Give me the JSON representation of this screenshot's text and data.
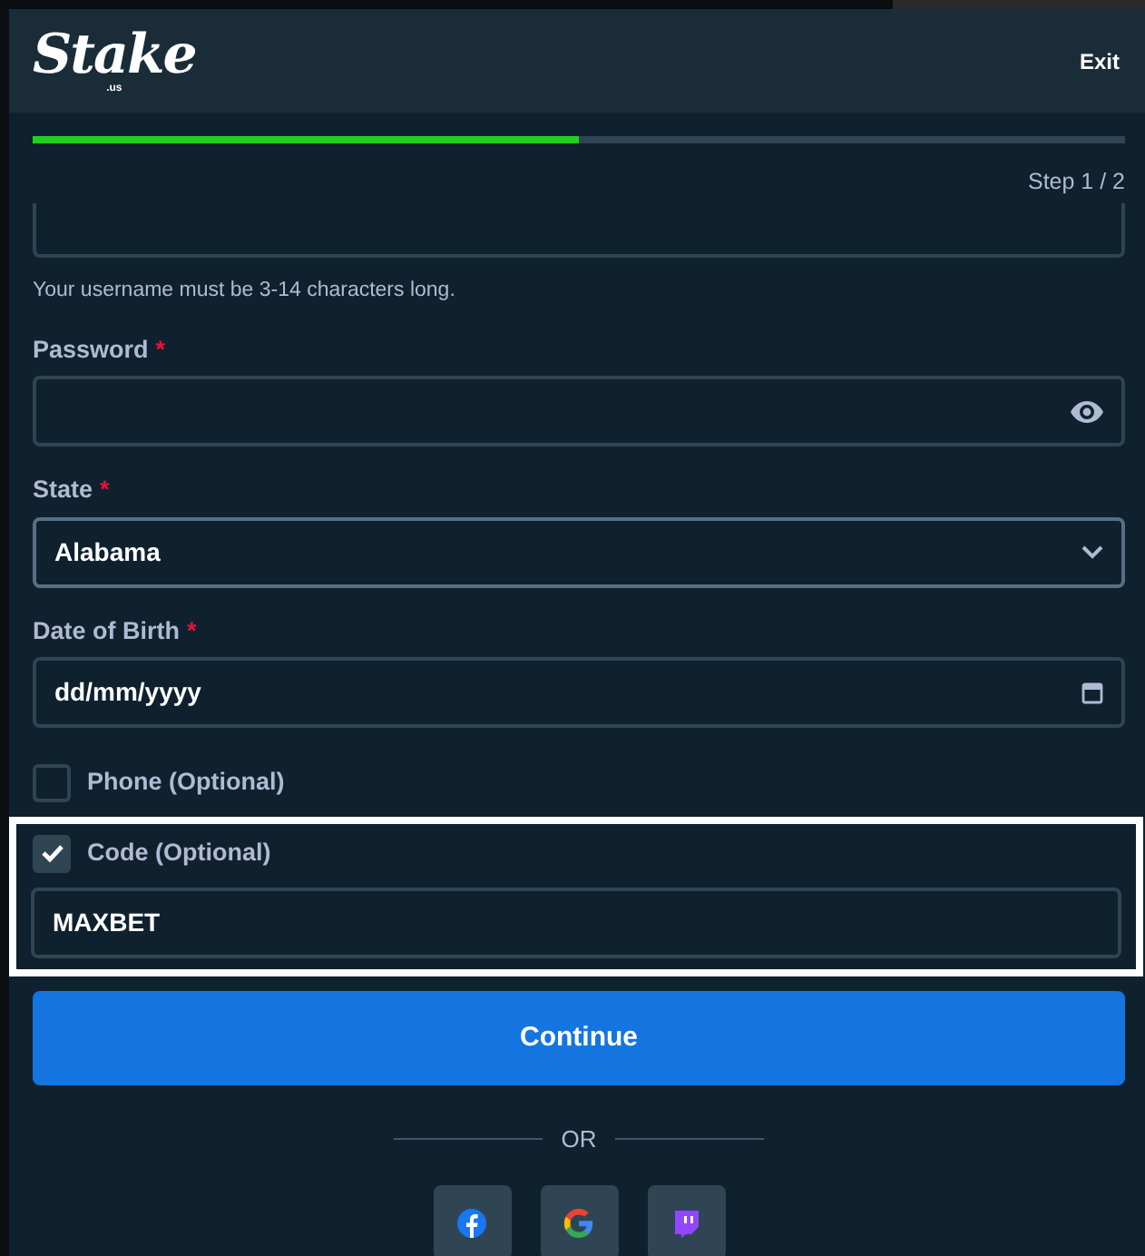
{
  "header": {
    "logo": "Stake",
    "logo_suffix": ".us",
    "exit": "Exit"
  },
  "progress": {
    "level": 0.5,
    "step": "Step 1 / 2"
  },
  "fields": [
    {
      "kind": "text",
      "hint": "Your username must be 3-14 characters long."
    },
    {
      "kind": "password",
      "label": "Password",
      "required_mark": "*"
    },
    {
      "kind": "select",
      "label": "State",
      "required_mark": "*",
      "value": "Alabama"
    },
    {
      "kind": "date",
      "label": "Date of Birth",
      "required_mark": "*",
      "value": "dd/mm/yyyy"
    }
  ],
  "options": [
    {
      "label": "Phone (Optional)",
      "checked": false,
      "highlighted": false
    },
    {
      "label": "Code (Optional)",
      "checked": true,
      "highlighted": true,
      "value": "MAXBET"
    }
  ],
  "continue": "Continue",
  "divider": "OR",
  "social": [
    {
      "kind": "facebook"
    },
    {
      "kind": "google"
    },
    {
      "kind": "twitch"
    }
  ]
}
